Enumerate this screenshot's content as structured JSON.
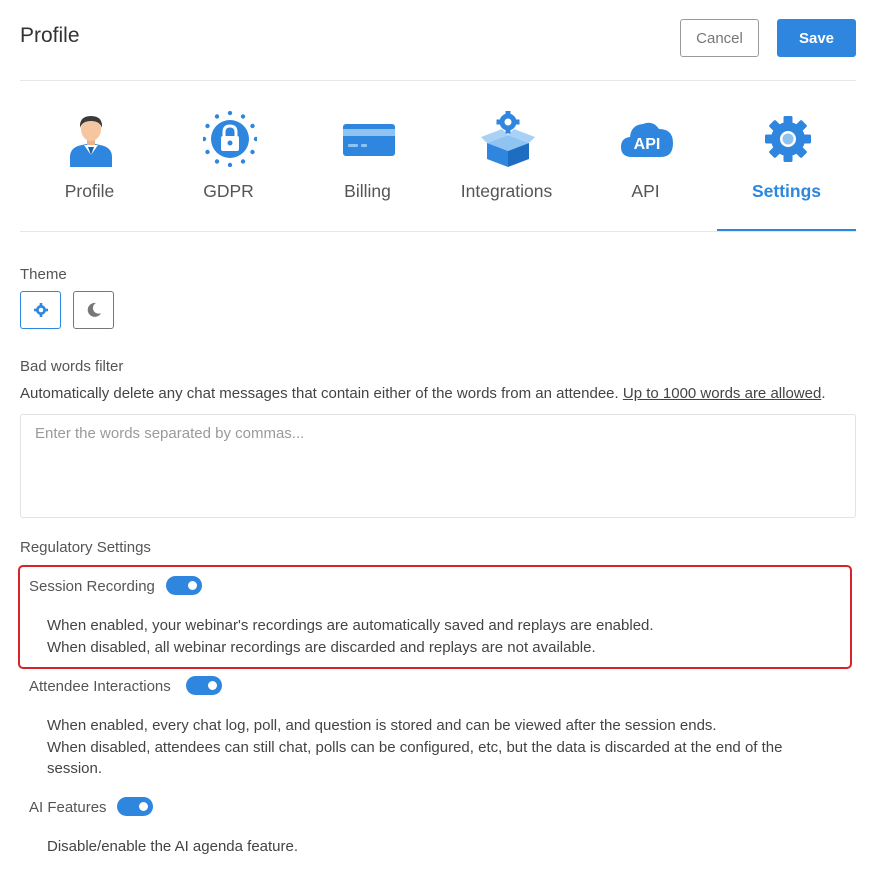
{
  "header": {
    "title": "Profile",
    "cancel_label": "Cancel",
    "save_label": "Save"
  },
  "tabs": [
    {
      "label": "Profile",
      "icon": "user-avatar-icon"
    },
    {
      "label": "GDPR",
      "icon": "eu-lock-icon"
    },
    {
      "label": "Billing",
      "icon": "credit-card-icon"
    },
    {
      "label": "Integrations",
      "icon": "box-gear-icon"
    },
    {
      "label": "API",
      "icon": "api-cloud-icon"
    },
    {
      "label": "Settings",
      "icon": "gear-icon",
      "active": true
    }
  ],
  "theme": {
    "label": "Theme",
    "options": [
      {
        "name": "light",
        "icon": "sun-icon",
        "selected": true
      },
      {
        "name": "dark",
        "icon": "moon-icon",
        "selected": false
      }
    ]
  },
  "bad_words": {
    "label": "Bad words filter",
    "description": "Automatically delete any chat messages that contain either of the words from an attendee.",
    "link_text": "Up to 1000 words are allowed",
    "suffix": ".",
    "placeholder": "Enter the words separated by commas...",
    "value": ""
  },
  "regulatory": {
    "label": "Regulatory Settings",
    "settings": [
      {
        "name": "Session Recording",
        "enabled": true,
        "lines": [
          "When enabled, your webinar's recordings are automatically saved and replays are enabled.",
          "When disabled, all webinar recordings are discarded and replays are not available."
        ]
      },
      {
        "name": "Attendee Interactions",
        "enabled": true,
        "lines": [
          "When enabled, every chat log, poll, and question is stored and can be viewed after the session ends.",
          "When disabled, attendees can still chat, polls can be configured, etc, but the data is discarded at the end of the session."
        ]
      },
      {
        "name": "AI Features",
        "enabled": true,
        "lines": [
          "Disable/enable the AI agenda feature."
        ]
      }
    ]
  },
  "colors": {
    "accent": "#2e86de",
    "highlight_border": "#d9232b"
  }
}
